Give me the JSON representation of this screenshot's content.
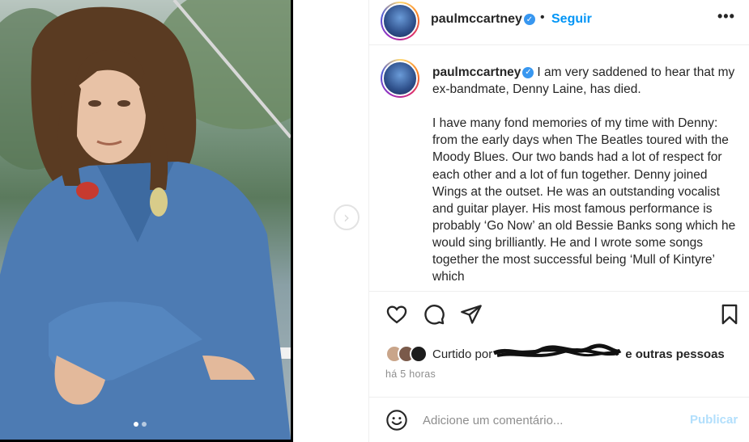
{
  "post": {
    "username": "paulmccartney",
    "follow_label": "Seguir",
    "separator": "•",
    "more_label": "•••",
    "caption_username": "paulmccartney",
    "caption": "I am very saddened to hear that my ex-bandmate, Denny Laine, has died.\n\nI have many fond memories of my time with Denny: from the early days when The Beatles toured with the Moody Blues. Our two bands had a lot of respect for each other and a lot of fun together. Denny joined Wings at the outset. He was an outstanding vocalist and guitar player. His most famous performance is probably ‘Go Now’ an old Bessie Banks song which he would sing brilliantly. He and I wrote some songs together the most successful being ‘Mull of Kintyre’ which",
    "verified_glyph": "✓"
  },
  "carousel": {
    "next_glyph": "›",
    "slide_count": 2,
    "current_slide": 1
  },
  "engagement": {
    "liked_prefix": "Curtido por",
    "liked_suffix": "e outras pessoas",
    "timestamp": "há 5 horas"
  },
  "comment": {
    "placeholder": "Adicione um comentário...",
    "publish_label": "Publicar"
  },
  "icons": {
    "like": "heart-icon",
    "comment": "comment-icon",
    "share": "share-icon",
    "save": "bookmark-icon",
    "emoji": "emoji-icon"
  },
  "colors": {
    "accent": "#0095f6",
    "publish_disabled": "#b2dffc",
    "verified": "#3897f0",
    "muted": "#8e8e8e"
  }
}
